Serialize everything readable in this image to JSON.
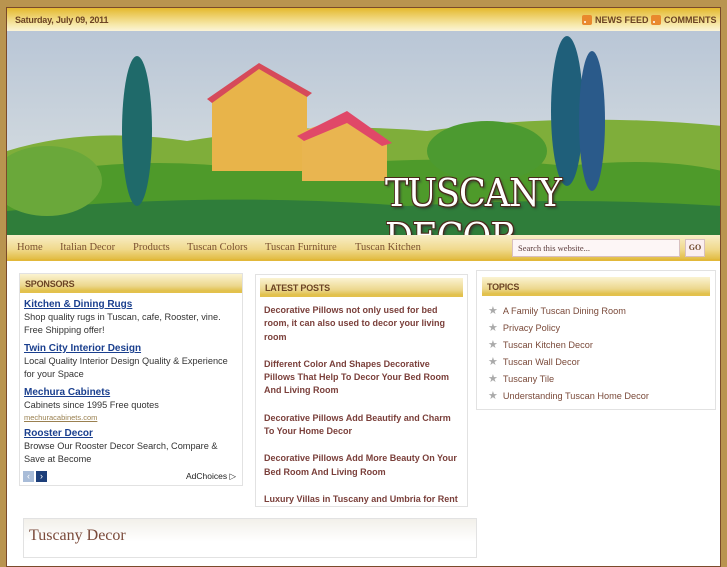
{
  "topbar": {
    "date": "Saturday, July 09, 2011",
    "news_feed": "NEWS FEED",
    "comments": "COMMENTS"
  },
  "header": {
    "title": "TUSCANY DECOR"
  },
  "nav": {
    "items": [
      "Home",
      "Italian Decor",
      "Products",
      "Tuscan Colors",
      "Tuscan Furniture",
      "Tuscan Kitchen"
    ],
    "search_placeholder": "Search this website...",
    "go": "GO"
  },
  "sponsors": {
    "title": "SPONSORS",
    "ads": [
      {
        "title": "Kitchen & Dining Rugs",
        "desc": "Shop quality rugs in Tuscan, cafe, Rooster, vine. Free Shipping offer!"
      },
      {
        "title": "Twin City Interior Design",
        "desc": "Local Quality Interior Design Quality & Experience for your Space"
      },
      {
        "title": "Mechura Cabinets",
        "desc": "Cabinets since 1995 Free quotes",
        "url": "mechuracabinets.com"
      },
      {
        "title": "Rooster Decor",
        "desc": "Browse Our Rooster Decor Search, Compare & Save at Become"
      }
    ],
    "adchoices": "AdChoices"
  },
  "latest": {
    "title": "LATEST POSTS",
    "posts": [
      "Decorative Pillows not only used for bed room, it can also used to decor your living room",
      "Different Color And Shapes Decorative Pillows That Help To Decor Your Bed Room And Living Room",
      "Decorative Pillows Add Beautify and Charm To Your Home Decor",
      "Decorative Pillows Add More Beauty On Your Bed Room And Living Room",
      "Luxury Villas in Tuscany and Umbria for Rent"
    ]
  },
  "topics": {
    "title": "TOPICS",
    "items": [
      "A Family Tuscan Dining Room",
      "Privacy Policy",
      "Tuscan Kitchen Decor",
      "Tuscan Wall Decor",
      "Tuscany Tile",
      "Understanding Tuscan Home Decor"
    ]
  },
  "bottom": {
    "title": "Tuscany Decor"
  }
}
